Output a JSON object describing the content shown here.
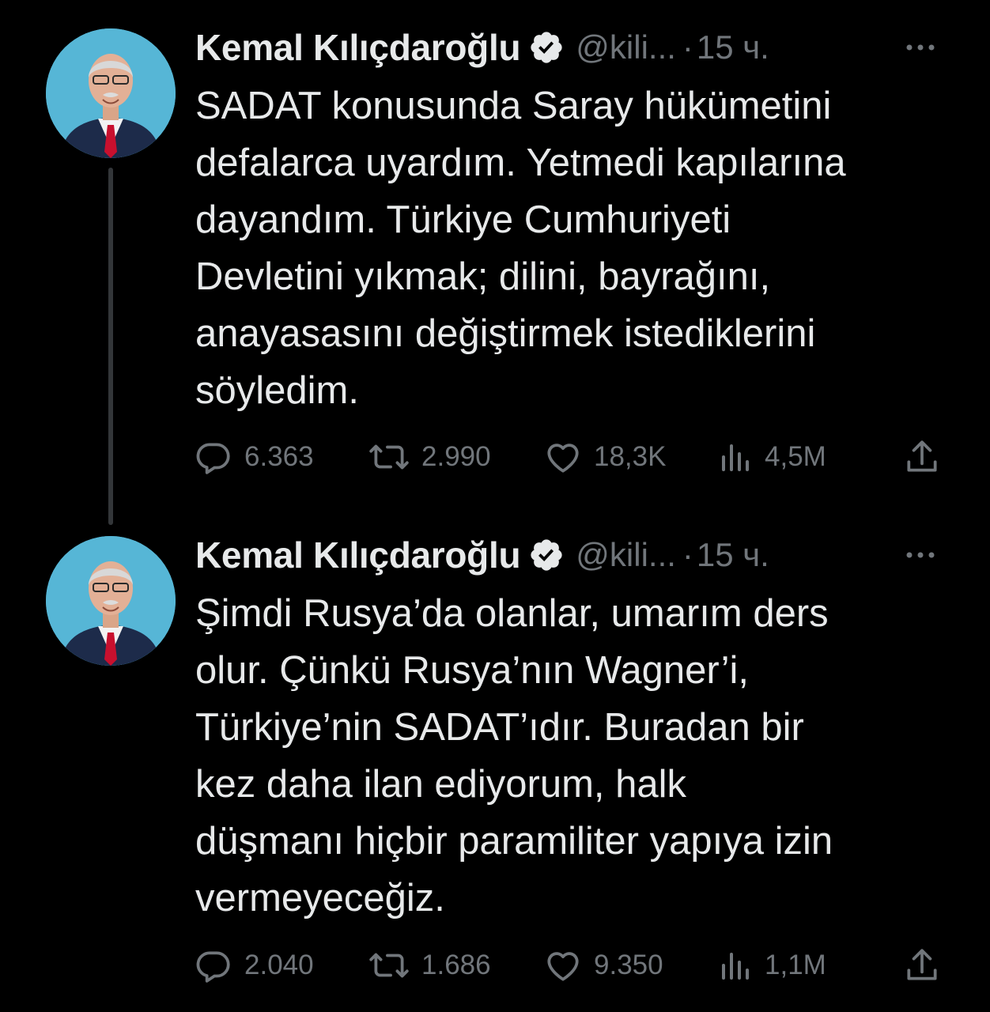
{
  "tweets": [
    {
      "author_name": "Kemal Kılıçdaroğlu",
      "handle": "@kili...",
      "separator": "·",
      "time": "15 ч.",
      "text": "SADAT konusunda Saray hükümetini\ndefalarca uyardım. Yetmedi kapılarına\ndayandım. Türkiye Cumhuriyeti\nDevletini yıkmak; dilini, bayrağını,\nanayasasını değiştirmek istediklerini\nsöyledim.",
      "replies": "6.363",
      "retweets": "2.990",
      "likes": "18,3K",
      "views": "4,5M"
    },
    {
      "author_name": "Kemal Kılıçdaroğlu",
      "handle": "@kili...",
      "separator": "·",
      "time": "15 ч.",
      "text": "Şimdi Rusya’da olanlar, umarım ders\nolur. Çünkü Rusya’nın Wagner’i,\nTürkiye’nin SADAT’ıdır. Buradan bir\nkez daha ilan ediyorum, halk\ndüşmanı hiçbir paramiliter yapıya izin\nvermeyeceğiz.",
      "replies": "2.040",
      "retweets": "1.686",
      "likes": "9.350",
      "views": "1,1M"
    }
  ],
  "colors": {
    "background": "#000000",
    "text": "#e7e9ea",
    "muted": "#71767b",
    "thread_line": "#333639",
    "verified_badge": "#e7e9ea"
  },
  "icons": [
    "verified-badge-icon",
    "more-icon",
    "reply-icon",
    "retweet-icon",
    "like-icon",
    "views-icon",
    "share-icon"
  ]
}
